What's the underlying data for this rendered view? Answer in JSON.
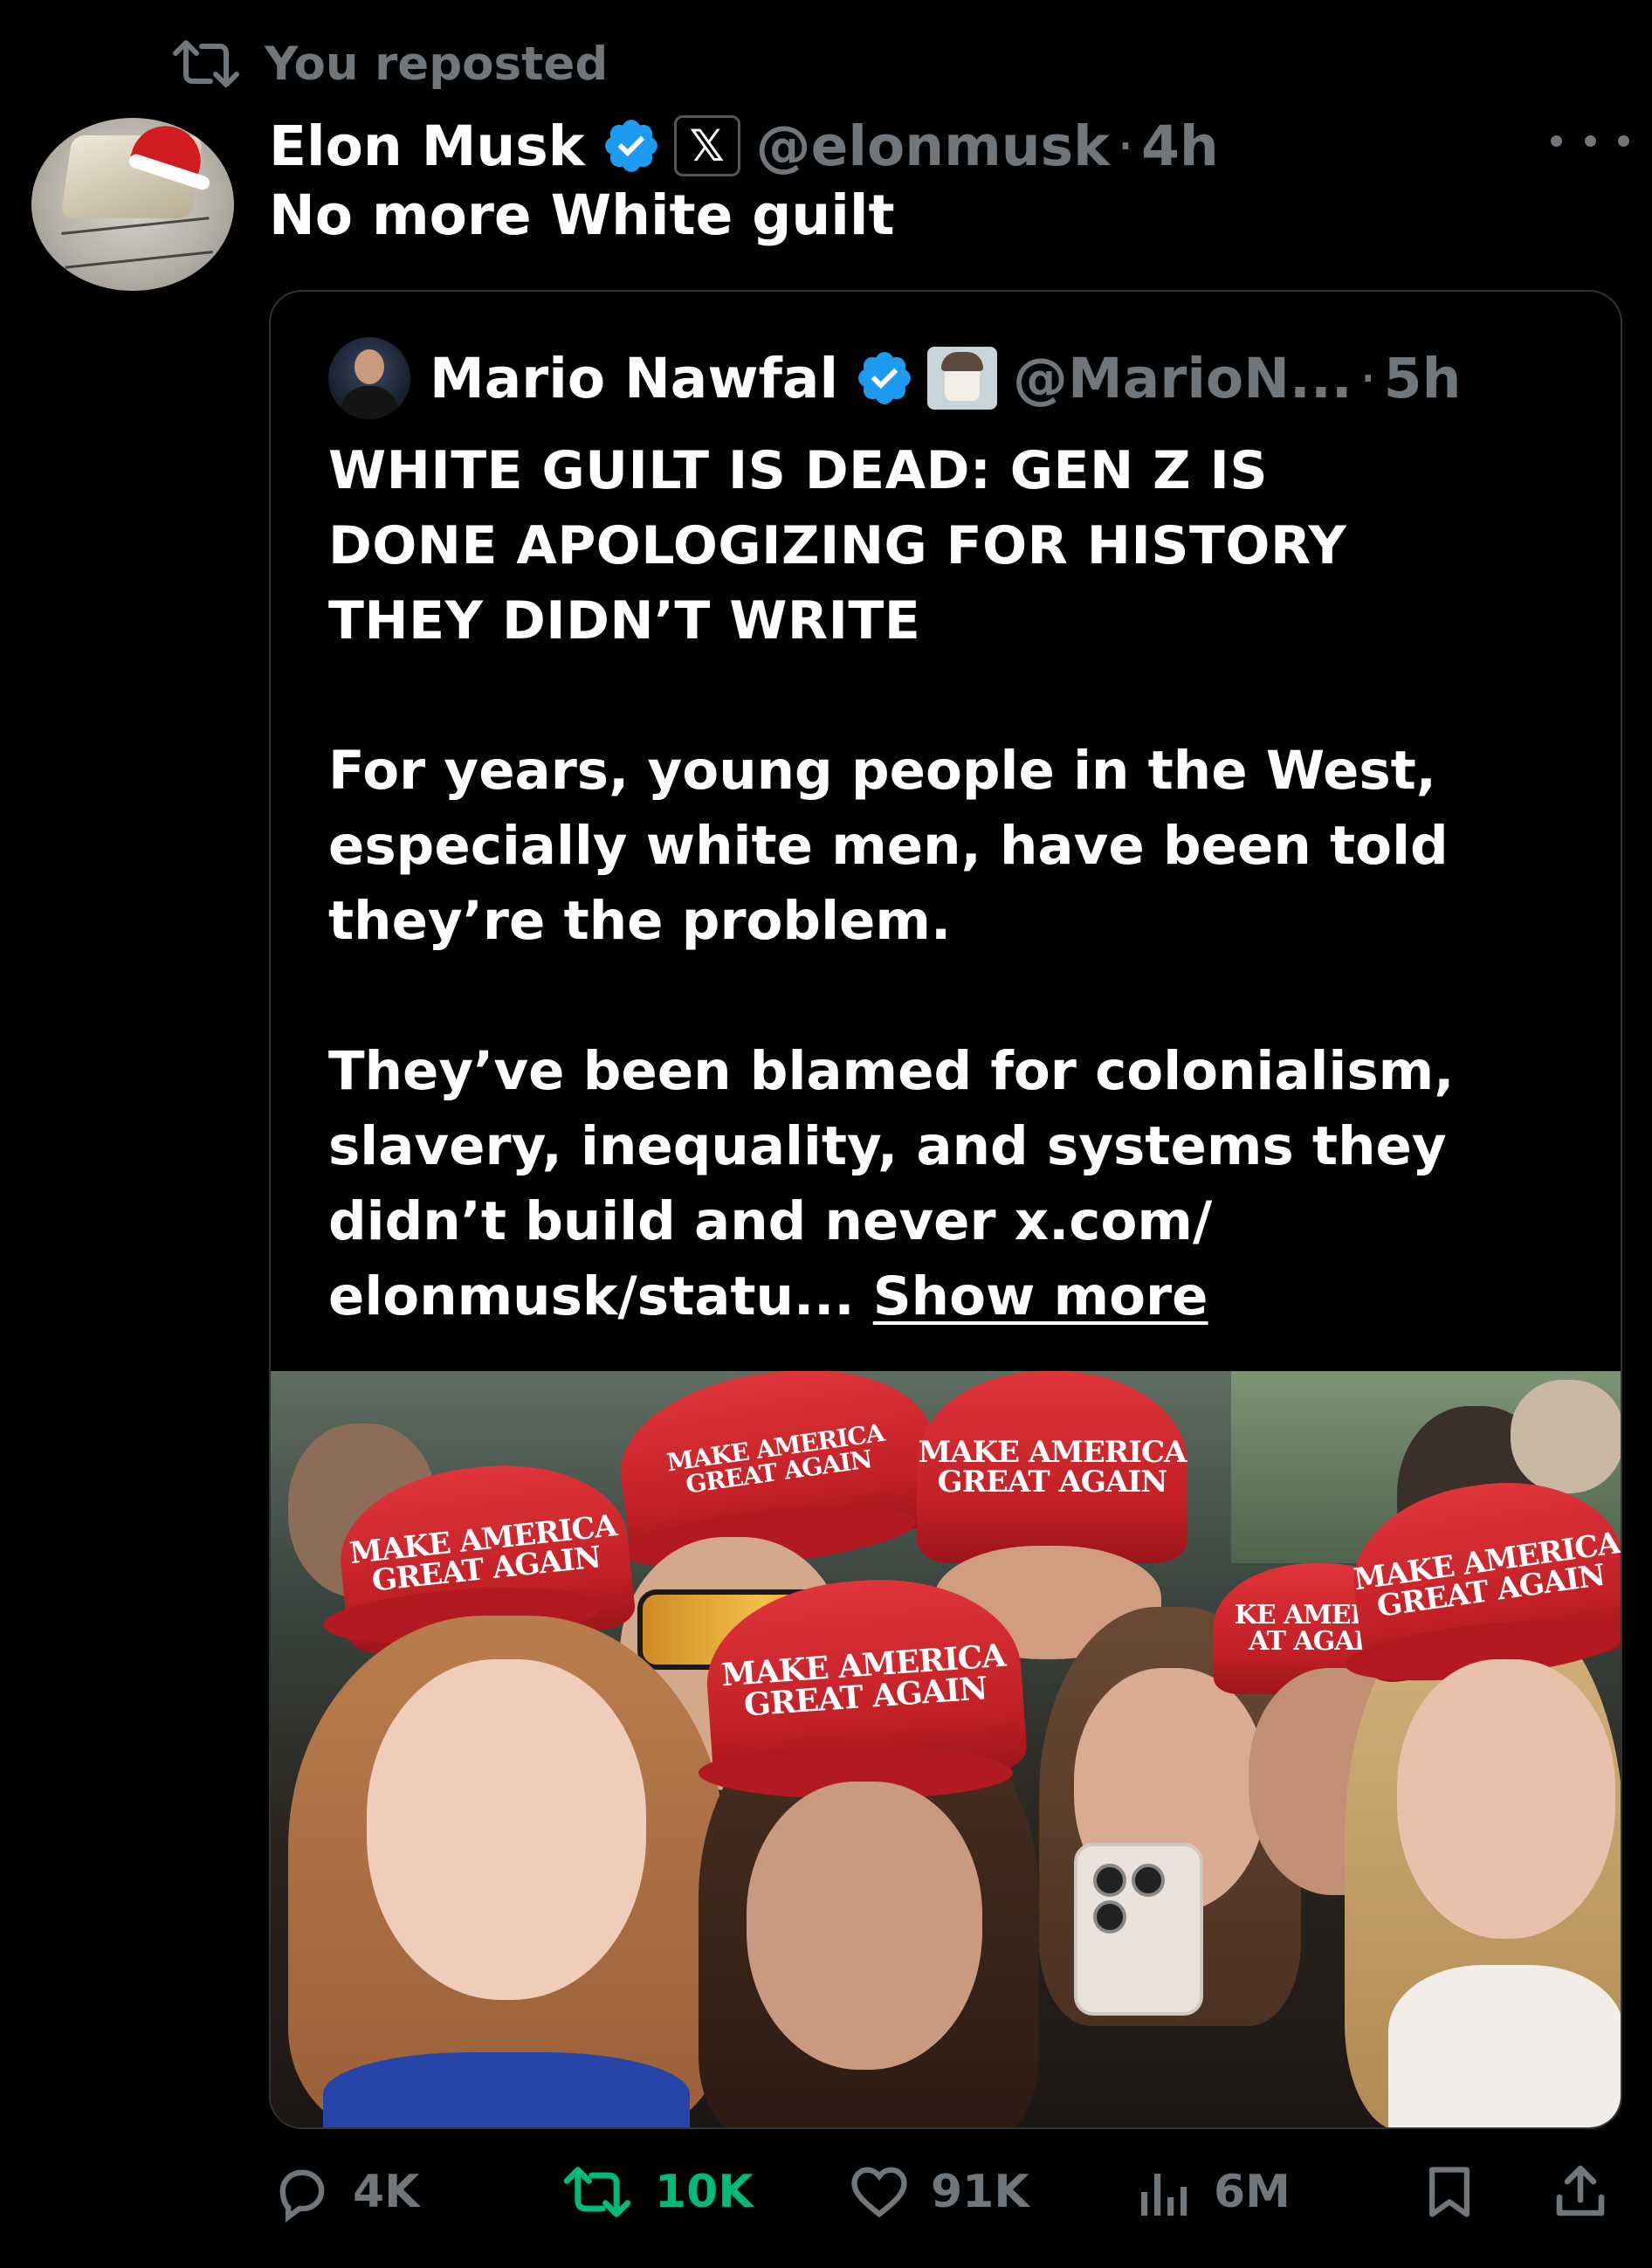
{
  "repost_banner": {
    "text": "You reposted",
    "icon": "repost-icon"
  },
  "tweet": {
    "author": "Elon Musk",
    "handle": "@elonmusk",
    "separator": "·",
    "time": "4h",
    "affiliate_label": "𝕏",
    "text": "No more White guilt",
    "more_icon": "more-icon"
  },
  "quote": {
    "author": "Mario Nawfal",
    "handle": "@MarioN...",
    "separator": "·",
    "time": "5h",
    "title_lines": [
      "WHITE GUILT IS DEAD: GEN Z IS",
      "DONE APOLOGIZING FOR HISTORY",
      "THEY DIDN’T WRITE"
    ],
    "para1_lines": [
      "For years, young people in the West,",
      "especially white men, have been told",
      "they’re the problem."
    ],
    "para2_lines": [
      "They’ve been blamed for colonialism,",
      "slavery, inequality, and systems they",
      "didn’t build and never x.com/",
      "elonmusk/statu... "
    ],
    "show_more": "Show more",
    "photo_caps": [
      [
        "MAKE AMERICA",
        "GREAT AGAIN"
      ],
      [
        "MAKE AMERICA",
        "GREAT AGAIN"
      ],
      [
        "MAKE AMERICA",
        "GREAT AGAIN"
      ],
      [
        "MAKE AMERICA",
        "GREAT AGAIN"
      ],
      [
        "KE AMERIC",
        "AT AGAIN"
      ],
      [
        "MAKE AMERICA",
        "GREAT AGAIN"
      ]
    ]
  },
  "actions": {
    "replies": "4K",
    "reposts": "10K",
    "likes": "91K",
    "views": "6M"
  },
  "colors": {
    "background": "#000000",
    "text": "#ffffff",
    "muted": "#71767b",
    "repost_green": "#00ba7c",
    "verified_blue": "#1d9bf0",
    "border": "#2f3336",
    "cap_red": "#c11f26"
  }
}
